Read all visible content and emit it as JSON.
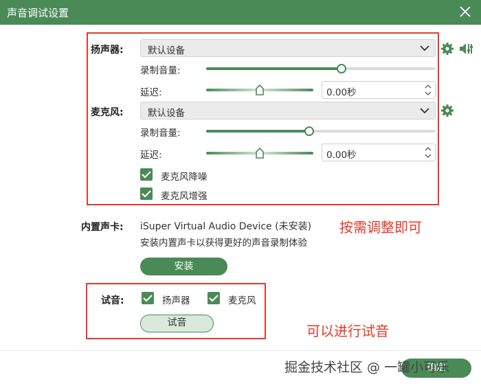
{
  "window": {
    "title": "声音调试设置"
  },
  "speaker": {
    "label": "扬声器:",
    "device": "默认设备",
    "volume_label": "录制音量:",
    "volume_level": 0.59,
    "delay_label": "延迟:",
    "delay_value": "0.00秒"
  },
  "mic": {
    "label": "麦克风:",
    "device": "默认设备",
    "volume_label": "录制音量:",
    "volume_level": 0.45,
    "delay_label": "延迟:",
    "delay_value": "0.00秒",
    "noise_reduction_label": "麦克风降噪",
    "noise_reduction_checked": true,
    "enhance_label": "麦克风增强",
    "enhance_checked": true
  },
  "soundcard": {
    "label": "内置声卡:",
    "device_name": "iSuper Virtual Audio Device (未安装)",
    "hint": "安装内置声卡以获得更好的声音录制体验",
    "install_label": "安装"
  },
  "test": {
    "label": "试音:",
    "speaker_label": "扬声器",
    "speaker_checked": true,
    "mic_label": "麦克风",
    "mic_checked": true,
    "button_label": "试音"
  },
  "annotations": {
    "adjust_note": "按需调整即可",
    "test_note": "可以进行试音"
  },
  "footer": {
    "watermark": "掘金技术社区 @ 一罐小可乐",
    "confirm_label": "确定"
  },
  "colors": {
    "accent": "#4a8a57",
    "annotation": "#e53a2a",
    "titlebar": "#4a8a57"
  },
  "icons": [
    "close-icon",
    "gear-icon",
    "volume-settings-icon",
    "chevron-down-icon",
    "check-icon"
  ]
}
